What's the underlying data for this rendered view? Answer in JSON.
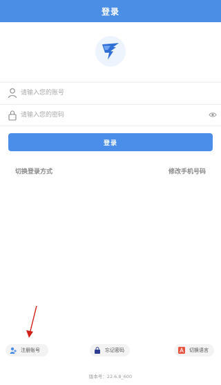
{
  "header": {
    "title": "登录"
  },
  "form": {
    "account_placeholder": "请输入您的账号",
    "password_placeholder": "请输入您的密码",
    "login_label": "登录"
  },
  "links": {
    "switch_login": "切换登录方式",
    "change_phone": "修改手机号码"
  },
  "bottom": {
    "register": "注册账号",
    "forgot": "忘记密码",
    "language": "切换语言"
  },
  "version": "版本号：22.6.8_600",
  "colors": {
    "primary": "#4a8ee6",
    "annotation_arrow": "#d0201a"
  },
  "icons": [
    "app-logo-icon",
    "user-icon",
    "lock-icon",
    "eye-icon",
    "register-icon",
    "forgot-lock-icon",
    "language-icon"
  ]
}
